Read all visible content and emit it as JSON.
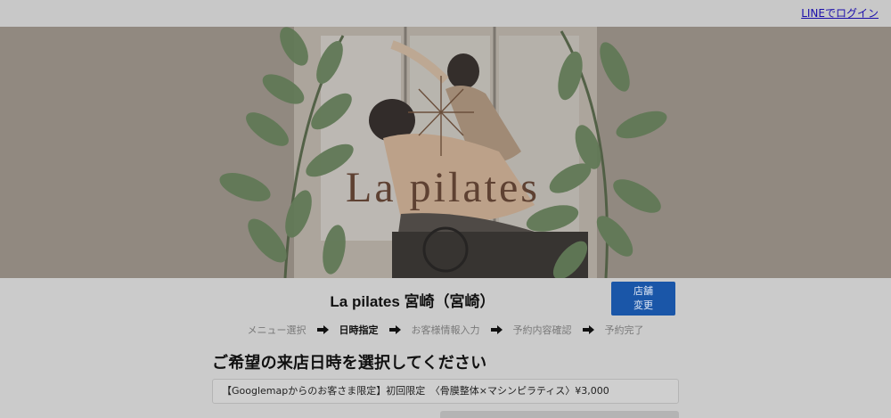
{
  "header": {
    "login_link": "LINEでログイン"
  },
  "hero": {
    "brand_logo_text": "La pilates"
  },
  "shop": {
    "title": "La pilates 宮崎（宮崎）",
    "change_store_button": "店舗\n変更"
  },
  "steps": [
    {
      "label": "メニュー選択",
      "active": false
    },
    {
      "label": "日時指定",
      "active": true
    },
    {
      "label": "お客様情報入力",
      "active": false
    },
    {
      "label": "予約内容確認",
      "active": false
    },
    {
      "label": "予約完了",
      "active": false
    }
  ],
  "main": {
    "heading": "ご希望の来店日時を選択してください",
    "selected_menu": "【Googlemapからのお客さま限定】初回限定　〈骨膜整体×マシンピラティス〉¥3,000"
  },
  "colors": {
    "overlay_bg": "#cbcbcb",
    "hero_bg": "#a59c92",
    "button_bg": "#1a56a8",
    "logo_text": "#6b4a3a",
    "leaf": "#6f8a63"
  }
}
